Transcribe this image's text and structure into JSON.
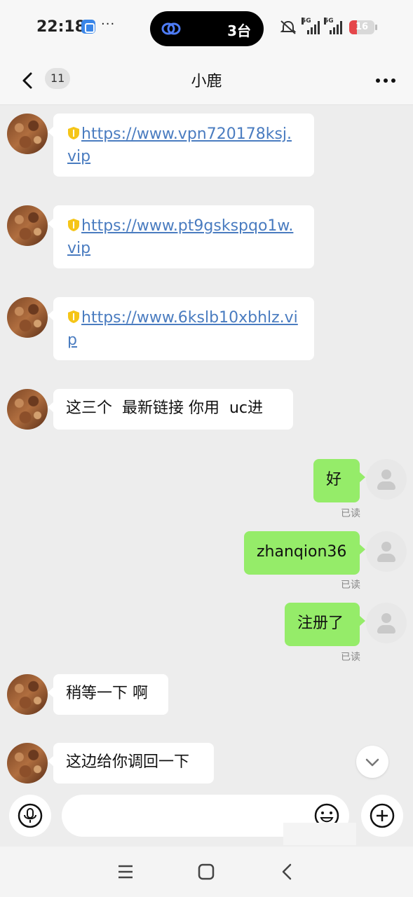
{
  "status_bar": {
    "time": "22:18",
    "notification_dots": "···",
    "island_text": "3台",
    "signal_1_label": "5G",
    "signal_2_label": "5G",
    "battery_level": "16"
  },
  "header": {
    "unread_count": "11",
    "title": "小鹿"
  },
  "messages": [
    {
      "link": "https://www.vpn720178ksj.vip"
    },
    {
      "link": "https://www.pt9gskspqo1w.vip"
    },
    {
      "link": "https://www.6kslb10xbhlz.vip"
    },
    {
      "text": "这三个  最新链接 你用  uc进"
    },
    {
      "text": "好",
      "read": "已读"
    },
    {
      "text": "zhanqion36",
      "read": "已读"
    },
    {
      "text": "注册了",
      "read": "已读"
    },
    {
      "text": "稍等一下 啊"
    },
    {
      "text": "这边给你调回一下"
    }
  ],
  "input": {
    "value": ""
  },
  "icons": {
    "back": "chevron-left-icon",
    "more": "more-horizontal-icon",
    "voice": "microphone-icon",
    "emoji": "emoji-icon",
    "plus": "plus-icon",
    "scroll": "chevron-down-icon",
    "shield": "shield-icon"
  },
  "colors": {
    "self_bubble": "#95ec69",
    "link": "#4a7cc0",
    "background": "#ededed"
  }
}
